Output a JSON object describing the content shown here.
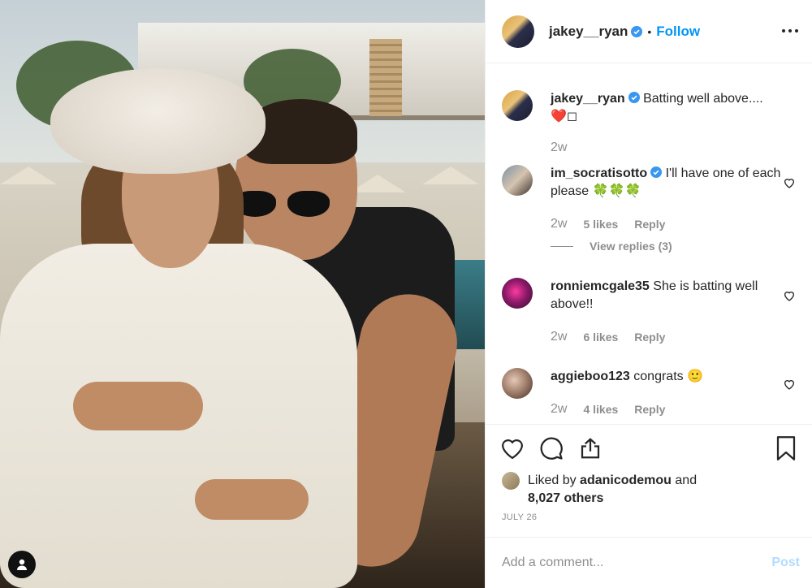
{
  "post": {
    "author": "jakey__ryan",
    "follow_label": "Follow",
    "dot": "•"
  },
  "caption": {
    "username": "jakey__ryan",
    "text": "Batting well above....",
    "emoji_line": "❤️◻",
    "time": "2w"
  },
  "comments": [
    {
      "username": "im_socratisotto",
      "verified": true,
      "text": "I'll have one of each please 🍀🍀🍀",
      "time": "2w",
      "likes": "5 likes",
      "reply_label": "Reply",
      "view_replies": "View replies (3)"
    },
    {
      "username": "ronniemcgale35",
      "verified": false,
      "text": "She is batting well above!!",
      "time": "2w",
      "likes": "6 likes",
      "reply_label": "Reply"
    },
    {
      "username": "aggieboo123",
      "verified": false,
      "text": "congrats 🙂",
      "time": "2w",
      "likes": "4 likes",
      "reply_label": "Reply"
    }
  ],
  "likes": {
    "prefix": "Liked by",
    "user": "adanicodemou",
    "and": "and",
    "others": "8,027 others"
  },
  "date": "JULY 26",
  "comment_box": {
    "placeholder": "Add a comment...",
    "post_label": "Post"
  },
  "colors": {
    "accent": "#0095f6",
    "verified": "#3897f0",
    "muted": "#8e8e8e",
    "post_disabled": "#b3dbff"
  }
}
